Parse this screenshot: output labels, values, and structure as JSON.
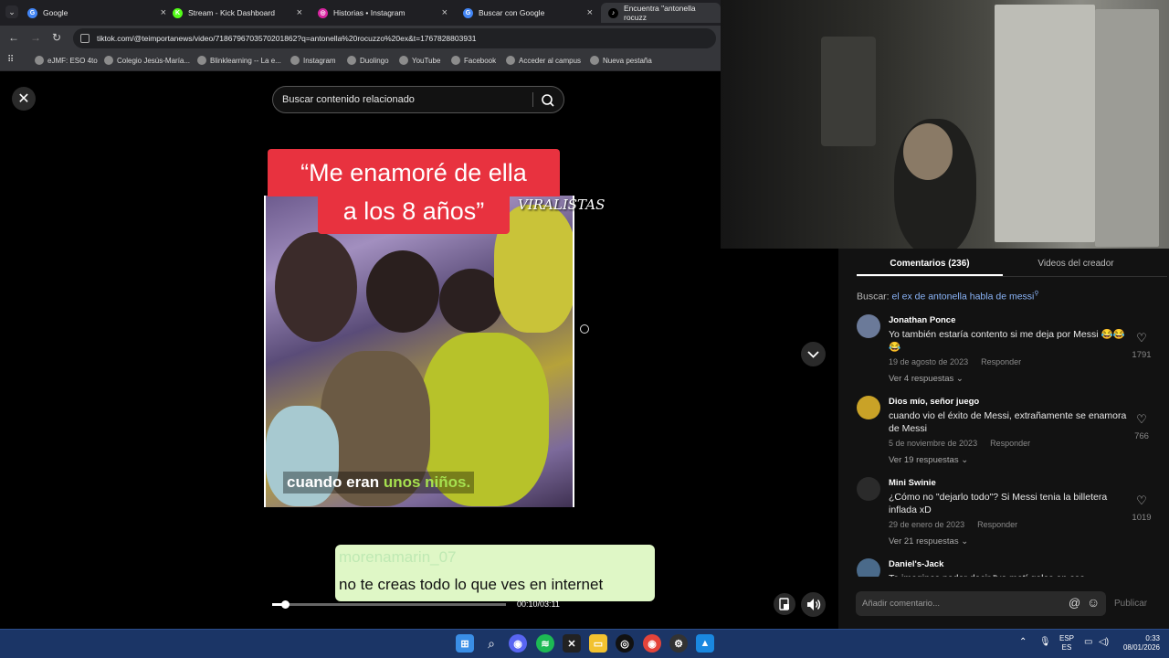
{
  "browser": {
    "tabs": [
      {
        "title": "Google",
        "favicon_color": "#4285f4",
        "favicon_letter": "G"
      },
      {
        "title": "Stream - Kick Dashboard",
        "favicon_color": "#53fc18",
        "favicon_letter": "K"
      },
      {
        "title": "Historias • Instagram",
        "favicon_color": "#d6249f",
        "favicon_letter": "◎"
      },
      {
        "title": "Buscar con Google",
        "favicon_color": "#4285f4",
        "favicon_letter": "G"
      },
      {
        "title": "Encuentra \"antonella rocuzz",
        "favicon_color": "#000000",
        "favicon_letter": "♪"
      }
    ],
    "url": "tiktok.com/@teimportanews/video/7186796703570201862?q=antonella%20rocuzzo%20ex&t=1767828803931",
    "bookmarks": [
      "eJMF: ESO 4to",
      "Colegio Jesús-María...",
      "Blinklearning -- La e...",
      "Instagram",
      "Duolingo",
      "YouTube",
      "Facebook",
      "Acceder al campus",
      "Nueva pestaña"
    ]
  },
  "search": {
    "placeholder": "Buscar contenido relacionado"
  },
  "video": {
    "headline_line1": "“Me enamoré de ella",
    "headline_line2": "a los 8 años”",
    "watermark": "VIRALISTAS",
    "subtitle_plain": "cuando eran ",
    "subtitle_highlight": "unos niños.",
    "chat_user": "morenamarin_07",
    "chat_message": "no te creas todo lo que ves en internet",
    "time": "00:10/03:11",
    "progress": 0.055
  },
  "panel": {
    "tab_comments": "Comentarios (236)",
    "tab_videos": "Videos del creador",
    "related_prefix": "Buscar: ",
    "related_query": "el ex de antonella habla de messi",
    "comments": [
      {
        "user": "Jonathan Ponce",
        "text": "Yo también estaría contento si me deja por Messi 😂😂😂",
        "date": "19 de agosto de 2023",
        "reply": "Responder",
        "replies": "Ver 4 respuestas ⌄",
        "likes": "1791"
      },
      {
        "user": "Dios mío, señor juego",
        "text": "cuando vio el éxito de Messi, extrañamente se enamora de Messi",
        "date": "5 de noviembre de 2023",
        "reply": "Responder",
        "replies": "Ver 19 respuestas ⌄",
        "likes": "766"
      },
      {
        "user": "Mini Swinie",
        "text": "¿Cómo no \"dejarlo todo\"? Si Messi tenia la billetera inflada xD",
        "date": "29 de enero de 2023",
        "reply": "Responder",
        "replies": "Ver 21 respuestas ⌄",
        "likes": "1019"
      },
      {
        "user": "Daniel's-Jack",
        "text": "Te imagines poder decir \"yo metí goles en ese",
        "date": "",
        "reply": "",
        "replies": "",
        "likes": ""
      }
    ],
    "comment_placeholder": "Añadir comentario...",
    "publish": "Publicar"
  },
  "taskbar": {
    "lang_1": "ESP",
    "lang_2": "ES",
    "time": "0:33",
    "date": "08/01/2026"
  }
}
